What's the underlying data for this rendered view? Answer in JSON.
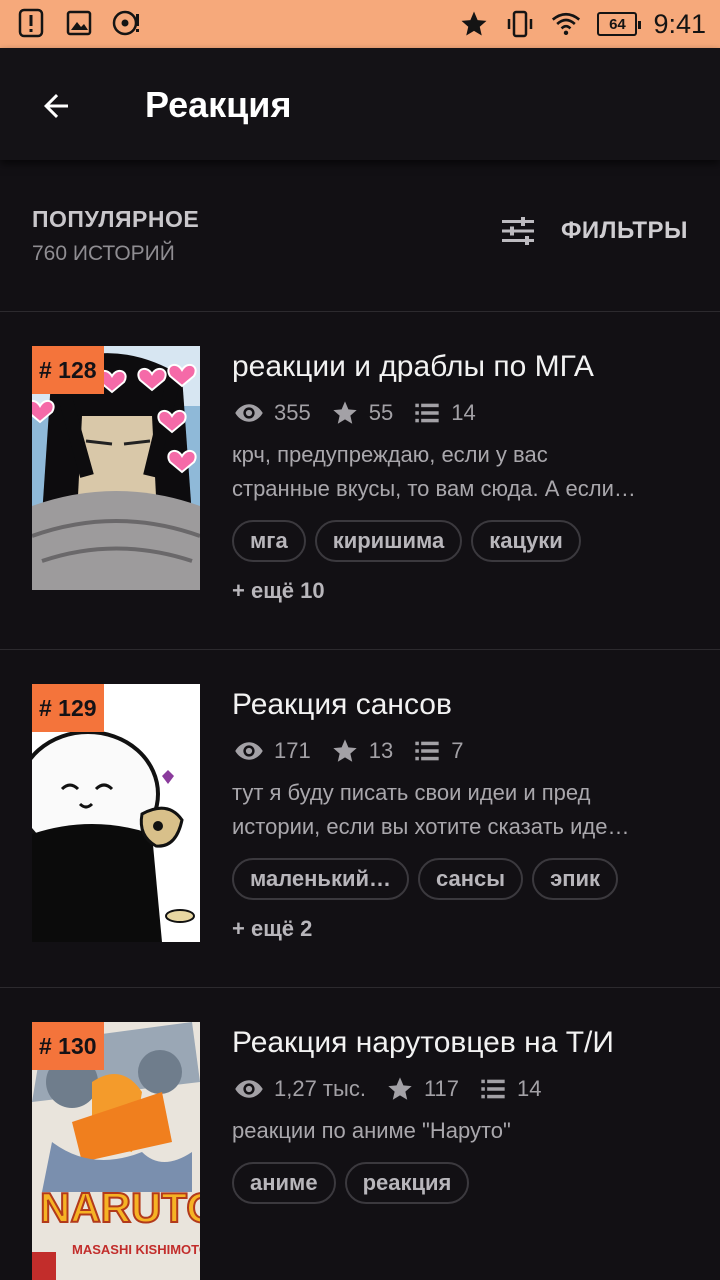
{
  "status_bar": {
    "time": "9:41",
    "battery": "64",
    "icons": [
      "alert-icon",
      "image-icon",
      "music-icon",
      "star-icon",
      "vibrate-icon",
      "wifi-icon",
      "battery-icon"
    ],
    "color": "#f6a97b"
  },
  "header": {
    "title": "Реакция",
    "back_icon": "arrow-left-icon"
  },
  "sort": {
    "label": "ПОПУЛЯРНОЕ",
    "count": "760 ИСТОРИЙ",
    "filter_label": "ФИЛЬТРЫ",
    "filter_icon": "sliders-icon"
  },
  "stories": [
    {
      "rank": "# 128",
      "title": "реакции и драблы по МГА",
      "views": "355",
      "stars": "55",
      "chapters": "14",
      "desc": [
        "крч, предупреждаю, если у вас",
        "странные вкусы, то вам сюда. А если…"
      ],
      "tags": [
        "мга",
        "киришима",
        "кацуки"
      ],
      "more": "+ ещё 10"
    },
    {
      "rank": "# 129",
      "title": "Реакция сансов",
      "views": "171",
      "stars": "13",
      "chapters": "7",
      "desc": [
        "тут я буду писать свои идеи и пред",
        "истории, если вы хотите сказать иде…"
      ],
      "tags": [
        "маленький…",
        "сансы",
        "эпик"
      ],
      "more": "+ ещё 2"
    },
    {
      "rank": "# 130",
      "title": "Реакция нарутовцев на Т/И",
      "views": "1,27 тыс.",
      "stars": "117",
      "chapters": "14",
      "desc": [
        "реакции по аниме \"Наруто\""
      ],
      "tags": [
        "аниме",
        "реакция"
      ],
      "more": "",
      "cover_text": "NARUTO",
      "cover_author": "MASASHI KISHIMOTO"
    }
  ],
  "colors": {
    "accent": "#f4743b",
    "background": "#121014"
  }
}
